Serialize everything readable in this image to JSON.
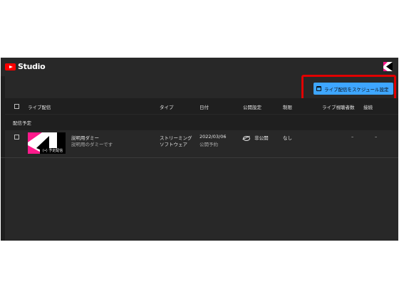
{
  "header": {
    "brand": "Studio"
  },
  "toolbar": {
    "schedule_label": "ライブ配信をスケジュール設定"
  },
  "table": {
    "columns": {
      "live": "ライブ配信",
      "type": "タイプ",
      "date": "日付",
      "visibility": "公開設定",
      "restrictions": "制限",
      "viewers": "ライブ視聴者数",
      "connection": "接続"
    },
    "section_title": "配信予定",
    "rows": [
      {
        "title": "説明用ダミー",
        "description": "説明用のダミーです",
        "thumbnail_badge": "(•) 予定配信",
        "type_line1": "ストリーミング",
        "type_line2": "ソフトウェア",
        "date": "2022/03/06",
        "date_status": "公開予約",
        "visibility": "非公開",
        "restrictions": "なし",
        "viewers": "–",
        "connection": "–"
      }
    ]
  },
  "colors": {
    "accent": "#3ea6ff",
    "highlight": "#e00000",
    "brand": "#ff0000",
    "background": "#282828"
  },
  "icons": [
    "youtube-logo-icon",
    "channel-avatar-icon",
    "calendar-icon",
    "visibility-off-icon"
  ]
}
